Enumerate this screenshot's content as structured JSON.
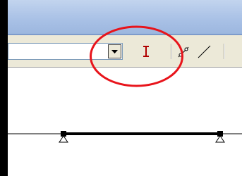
{
  "window": {
    "title": ""
  },
  "toolbar": {
    "combo_value": "",
    "combo_button_icon": "dropdown-arrow-icon",
    "tools": [
      {
        "name": "text-cursor-tool",
        "icon": "i-beam-icon",
        "color": "#b00000"
      },
      {
        "name": "node-line-tool",
        "icon": "node-line-icon"
      },
      {
        "name": "line-tool",
        "icon": "line-icon"
      }
    ]
  },
  "canvas": {
    "elements": [
      "beam",
      "left-support",
      "right-support"
    ]
  },
  "annotation": {
    "color": "#e8141b"
  }
}
